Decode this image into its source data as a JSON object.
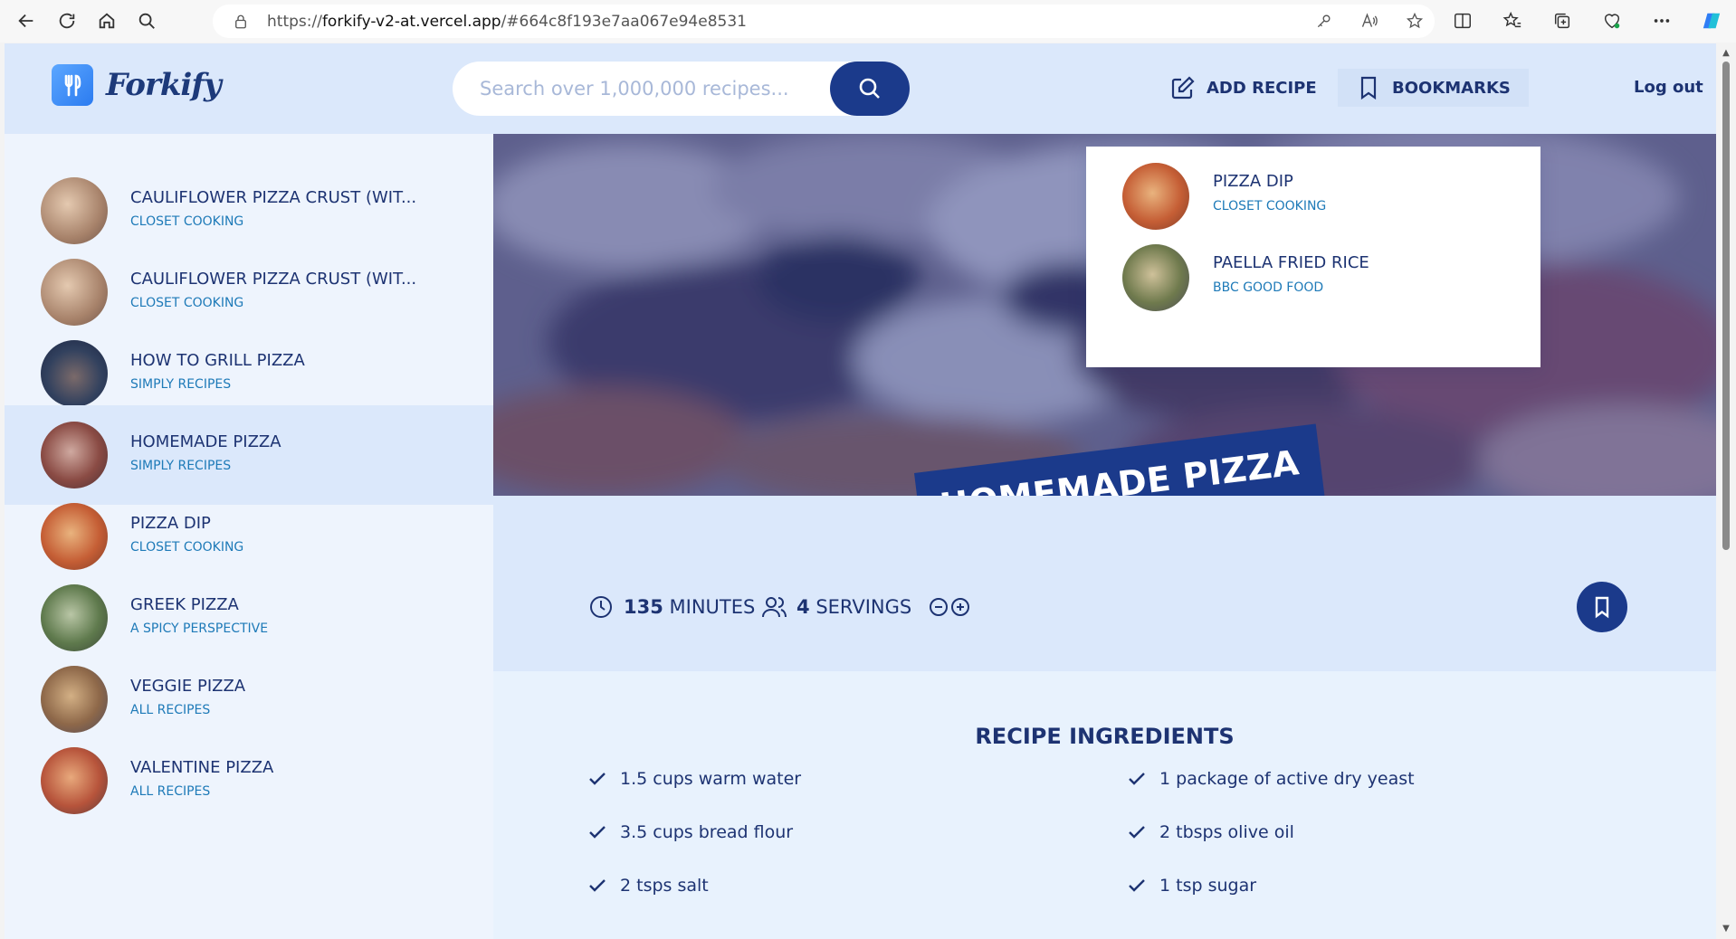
{
  "browser": {
    "url_prefix": "https://",
    "url_host": "forkify-v2-at.vercel.app",
    "url_rest": "/#664c8f193e7aa067e94e8531"
  },
  "header": {
    "logo_text": "Forkify",
    "search_placeholder": "Search over 1,000,000 recipes...",
    "add_recipe_label": "ADD RECIPE",
    "bookmarks_label": "BOOKMARKS",
    "logout_label": "Log out"
  },
  "results": [
    {
      "title": "CAULIFLOWER PIZZA CRUST (WIT...",
      "publisher": "CLOSET COOKING",
      "active": false
    },
    {
      "title": "CAULIFLOWER PIZZA CRUST (WIT...",
      "publisher": "CLOSET COOKING",
      "active": false
    },
    {
      "title": "HOW TO GRILL PIZZA",
      "publisher": "SIMPLY RECIPES",
      "active": false
    },
    {
      "title": "HOMEMADE PIZZA",
      "publisher": "SIMPLY RECIPES",
      "active": true
    },
    {
      "title": "PIZZA DIP",
      "publisher": "CLOSET COOKING",
      "active": false
    },
    {
      "title": "GREEK PIZZA",
      "publisher": "A SPICY PERSPECTIVE",
      "active": false
    },
    {
      "title": "VEGGIE PIZZA",
      "publisher": "ALL RECIPES",
      "active": false
    },
    {
      "title": "VALENTINE PIZZA",
      "publisher": "ALL RECIPES",
      "active": false
    }
  ],
  "bookmarks": [
    {
      "title": "PIZZA DIP",
      "publisher": "CLOSET COOKING"
    },
    {
      "title": "PAELLA FRIED RICE",
      "publisher": "BBC GOOD FOOD"
    }
  ],
  "recipe": {
    "title": "HOMEMADE PIZZA",
    "minutes_value": "135",
    "minutes_label": "MINUTES",
    "servings_value": "4",
    "servings_label": "SERVINGS",
    "ingredients_heading": "RECIPE INGREDIENTS",
    "ingredients": [
      "1.5 cups warm water",
      "1 package of active dry yeast",
      "3.5 cups bread flour",
      "2 tbsps olive oil",
      "2 tsps salt",
      "1 tsp sugar"
    ]
  },
  "colors": {
    "accent": "#1b3a8b",
    "header_bg": "#dbe8fb",
    "publisher_text": "#1e7ab8"
  }
}
